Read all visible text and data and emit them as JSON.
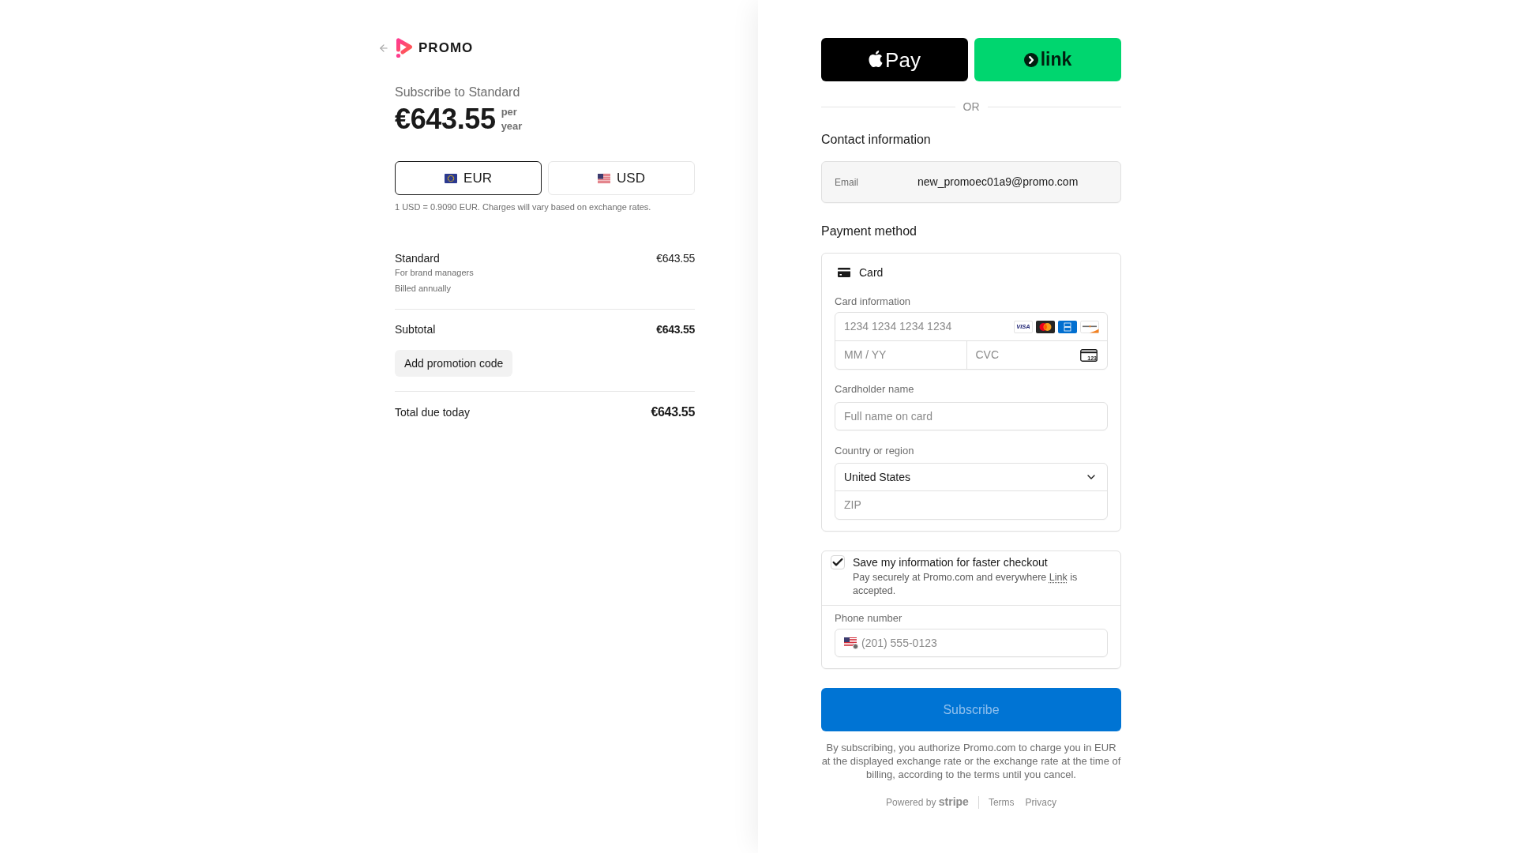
{
  "header": {
    "brand": "PROMO"
  },
  "summary": {
    "title": "Subscribe to Standard",
    "price": "€643.55",
    "period": "per year"
  },
  "currencies": [
    {
      "code": "EUR",
      "kind": "eu",
      "selected": true
    },
    {
      "code": "USD",
      "kind": "us",
      "selected": false
    }
  ],
  "exchange_note": "1 USD = 0.9090 EUR. Charges will vary based on exchange rates.",
  "line_items": [
    {
      "name": "Standard",
      "description": "For brand managers",
      "billing": "Billed annually",
      "amount": "€643.55"
    }
  ],
  "subtotal": {
    "label": "Subtotal",
    "amount": "€643.55"
  },
  "promotion_button": "Add promotion code",
  "total": {
    "label": "Total due today",
    "amount": "€643.55"
  },
  "express_checkout": [
    {
      "kind": "apple_pay",
      "label": "Pay"
    },
    {
      "kind": "link",
      "label": "link"
    }
  ],
  "separator": "OR",
  "contact": {
    "heading": "Contact information",
    "email_label": "Email",
    "email": "new_promoec01a9@promo.com"
  },
  "payment": {
    "heading": "Payment method",
    "method": "Card",
    "card_information_label": "Card information",
    "card_number_placeholder": "1234 1234 1234 1234",
    "card_brands": [
      {
        "kind": "visa",
        "label": "VISA"
      },
      {
        "kind": "mastercard"
      },
      {
        "kind": "amex"
      },
      {
        "kind": "discover"
      }
    ],
    "expiry_placeholder": "MM / YY",
    "cvc_placeholder": "CVC",
    "cvc_icon_text": "123",
    "cardholder_label": "Cardholder name",
    "cardholder_placeholder": "Full name on card",
    "country_label": "Country or region",
    "country": "United States",
    "zip_placeholder": "ZIP"
  },
  "save_info": {
    "checked": true,
    "title": "Save my information for faster checkout",
    "description_start": "Pay securely at Promo.com and everywhere",
    "link": "Link",
    "description_end": "is accepted.",
    "phone_label": "Phone number",
    "phone_placeholder": "(201) 555-0123"
  },
  "subscribe": {
    "label": "Subscribe",
    "disabled": true
  },
  "disclaimer": "By subscribing, you authorize Promo.com to charge you in EUR at the displayed exchange rate or the exchange rate at the time of billing, according to the terms until you cancel.",
  "footer": {
    "powered_by": "Powered by **stripe**",
    "links": [
      "Terms",
      "Privacy"
    ]
  }
}
